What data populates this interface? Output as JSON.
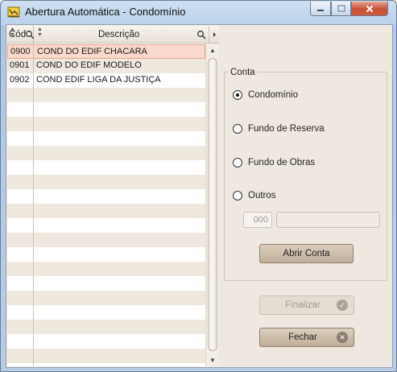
{
  "window": {
    "title": "Abertura Automática - Condomínio"
  },
  "grid": {
    "columns": [
      "Cód",
      "Descrição"
    ],
    "rows": [
      {
        "cod": "0900",
        "desc": "COND DO EDIF CHACARA",
        "selected": true
      },
      {
        "cod": "0901",
        "desc": "COND DO EDIF MODELO",
        "selected": false
      },
      {
        "cod": "0902",
        "desc": "COND EDIF LIGA DA JUSTIÇA",
        "selected": false
      }
    ]
  },
  "conta": {
    "legend": "Conta",
    "options": [
      {
        "label": "Condomínio",
        "checked": true
      },
      {
        "label": "Fundo de Reserva",
        "checked": false
      },
      {
        "label": "Fundo de Obras",
        "checked": false
      },
      {
        "label": "Outros",
        "checked": false
      }
    ],
    "code_placeholder": "000",
    "abrir_label": "Abrir Conta"
  },
  "buttons": {
    "finalizar": "Finalizar",
    "fechar": "Fechar"
  },
  "colors": {
    "selected_row": "#f9d9cb",
    "panel_bg": "#efe8e0",
    "button": "#cdbfad"
  }
}
